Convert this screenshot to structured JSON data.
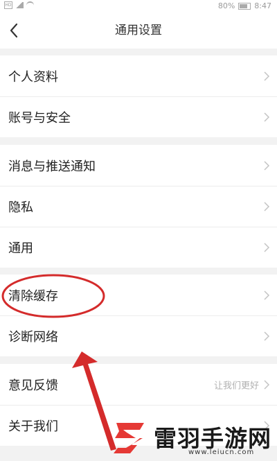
{
  "status_bar": {
    "sim_label": "HD",
    "battery": "80%",
    "time": "8:47"
  },
  "header": {
    "title": "通用设置"
  },
  "groups": [
    {
      "items": [
        {
          "label": "个人资料"
        },
        {
          "label": "账号与安全"
        }
      ]
    },
    {
      "items": [
        {
          "label": "消息与推送通知"
        },
        {
          "label": "隐私"
        },
        {
          "label": "通用"
        }
      ]
    },
    {
      "items": [
        {
          "label": "清除缓存"
        },
        {
          "label": "诊断网络"
        }
      ]
    },
    {
      "items": [
        {
          "label": "意见反馈",
          "value": "让我们更好"
        },
        {
          "label": "关于我们"
        }
      ]
    }
  ],
  "annotation": {
    "highlight_target": "清除缓存",
    "color": "#d42b2b"
  },
  "watermark": {
    "text": "雷羽手游网",
    "url": "www.leiucn.com",
    "logo_color": "#e53935"
  },
  "icons": {
    "back": "back-arrow-icon",
    "chevron": "chevron-right-icon"
  }
}
